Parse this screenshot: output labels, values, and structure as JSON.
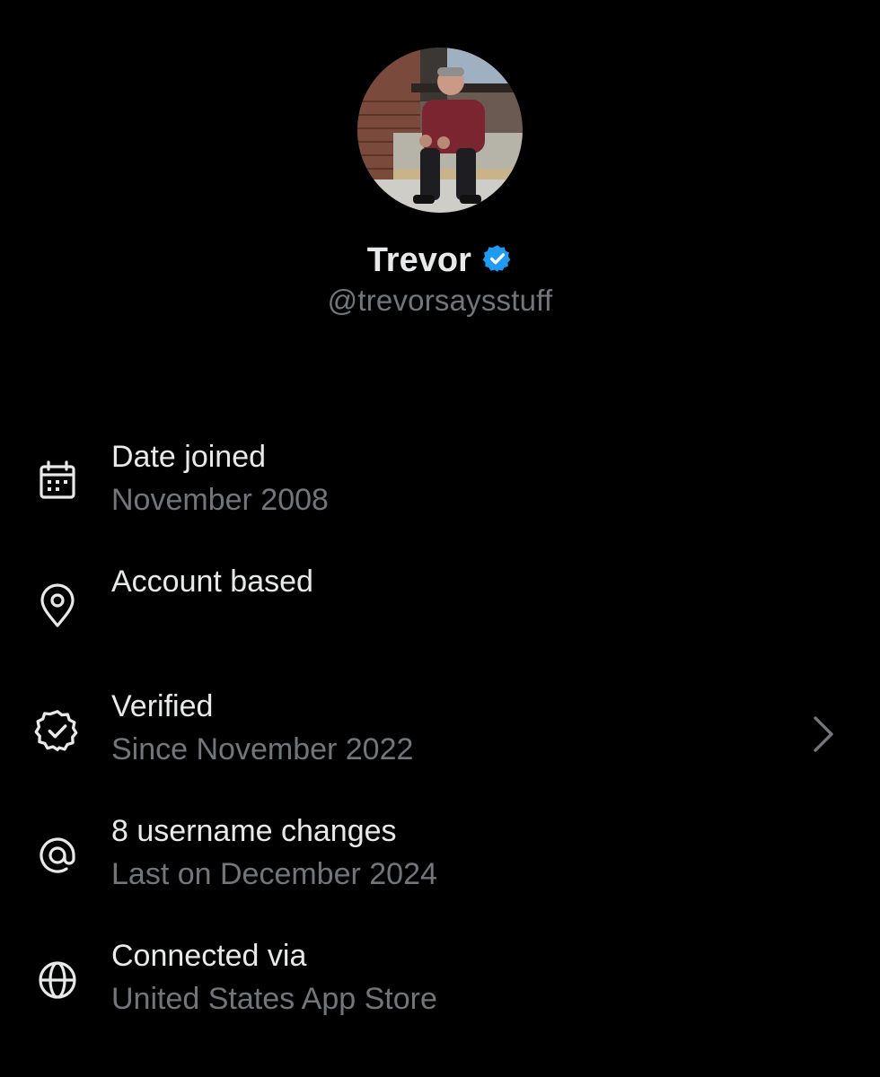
{
  "profile": {
    "display_name": "Trevor",
    "handle": "@trevorsaysstuff",
    "verified_badge_color": "#1d9bf0",
    "avatar_icon": "avatar-photo"
  },
  "info_rows": [
    {
      "icon": "calendar-icon",
      "title": "Date joined",
      "subtitle": "November 2008",
      "has_chevron": false
    },
    {
      "icon": "location-pin-icon",
      "title": "Account based",
      "subtitle": "",
      "has_chevron": false
    },
    {
      "icon": "verified-badge-outline-icon",
      "title": "Verified",
      "subtitle": "Since November 2022",
      "has_chevron": true
    },
    {
      "icon": "at-sign-icon",
      "title": "8 username changes",
      "subtitle": "Last on December 2024",
      "has_chevron": false
    },
    {
      "icon": "globe-icon",
      "title": "Connected via",
      "subtitle": "United States App Store",
      "has_chevron": false
    }
  ],
  "colors": {
    "background": "#000000",
    "primary_text": "#e7e9ea",
    "secondary_text": "#71767b",
    "accent": "#1d9bf0"
  }
}
